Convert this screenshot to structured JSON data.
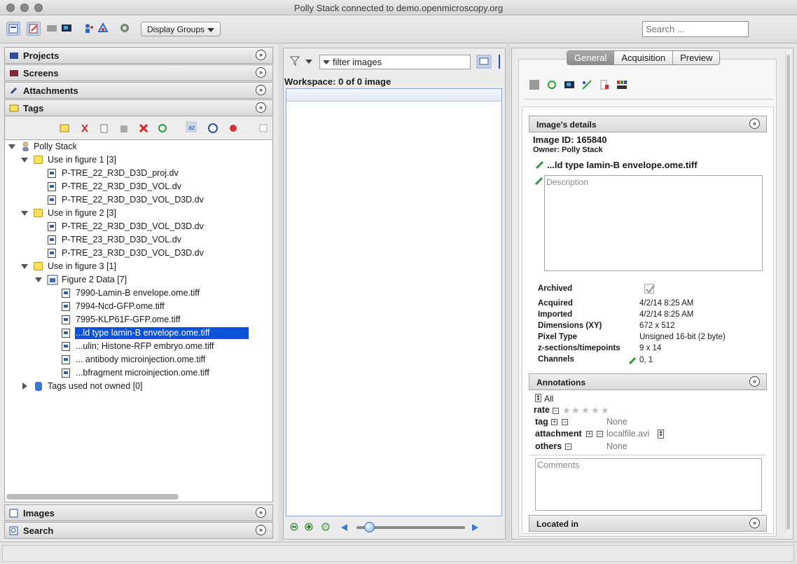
{
  "window": {
    "title": "Polly Stack connected to demo.openmicroscopy.org"
  },
  "toolbar": {
    "display_groups": "Display Groups",
    "search_placeholder": "Search ..."
  },
  "left": {
    "sections": {
      "projects": "Projects",
      "screens": "Screens",
      "attachments": "Attachments",
      "tags": "Tags",
      "images": "Images",
      "search": "Search"
    },
    "tree": {
      "root": "Polly Stack",
      "fig1": "Use in figure 1 [3]",
      "fig1_items": [
        "P-TRE_22_R3D_D3D_proj.dv",
        "P-TRE_22_R3D_D3D_VOL.dv",
        "P-TRE_22_R3D_D3D_VOL_D3D.dv"
      ],
      "fig2": "Use in figure 2 [3]",
      "fig2_items": [
        "P-TRE_22_R3D_D3D_VOL_D3D.dv",
        "P-TRE_23_R3D_D3D_VOL.dv",
        "P-TRE_23_R3D_D3D_VOL_D3D.dv"
      ],
      "fig3": "Use in figure 3 [1]",
      "dataset": "Figure 2 Data [7]",
      "dataset_items": [
        "7990-Lamin-B envelope.ome.tiff",
        "7994-Ncd-GFP.ome.tiff",
        "7995-KLP61F-GFP.ome.tiff",
        "...ld type lamin-B envelope.ome.tiff",
        "...ulin; Histone-RFP embryo.ome.tiff",
        "... antibody microinjection.ome.tiff",
        "...bfragment microinjection.ome.tiff"
      ],
      "not_owned": "Tags used not owned [0]"
    }
  },
  "center": {
    "filter_placeholder": "filter  images",
    "workspace": "Workspace: 0 of 0 image"
  },
  "right": {
    "tabs": [
      "General",
      "Acquisition",
      "Preview"
    ],
    "image_details": "Image's details",
    "image_id": "Image ID: 165840",
    "owner": "Owner: Polly Stack",
    "image_name": "...ld type lamin-B envelope.ome.tiff",
    "description_placeholder": "Description",
    "archived": "Archived",
    "fields": [
      {
        "label": "Acquired",
        "value": "4/2/14 8:25 AM"
      },
      {
        "label": "Imported",
        "value": "4/2/14 8:25 AM"
      },
      {
        "label": "Dimensions (XY)",
        "value": "672 x 512"
      },
      {
        "label": "Pixel Type",
        "value": "Unsigned 16-bit (2 byte)"
      },
      {
        "label": "z-sections/timepoints",
        "value": "9 x 14"
      },
      {
        "label": "Channels",
        "value": "0, 1"
      }
    ],
    "annotations": "Annotations",
    "all": "All",
    "rate": "rate",
    "tag": "tag",
    "tag_value": "None",
    "attachment": "attachment",
    "attachment_value": "localfile.avi",
    "others": "others",
    "others_value": "None",
    "comments_placeholder": "Comments",
    "located_in": "Located in"
  },
  "colors": {
    "selection": "#0a52d6",
    "tag_yellow": "#ffe15a"
  }
}
